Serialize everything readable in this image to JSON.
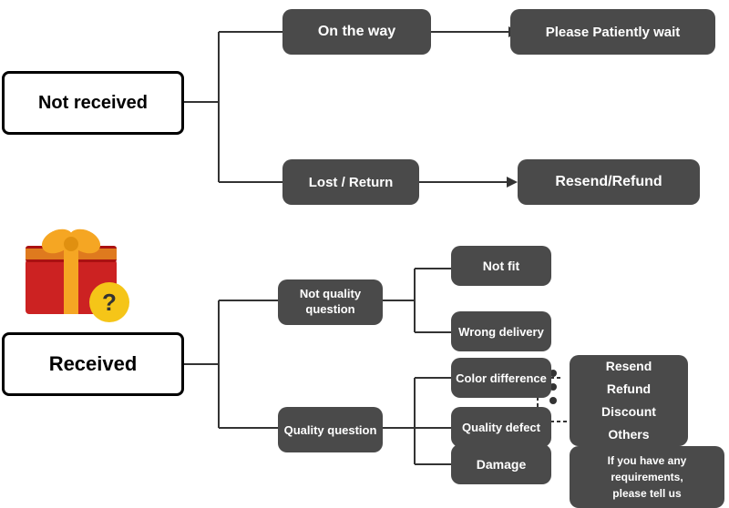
{
  "boxes": {
    "not_received": "Not received",
    "on_the_way": "On the way",
    "please_wait": "Please Patiently wait",
    "lost_return": "Lost / Return",
    "resend_refund": "Resend/Refund",
    "received": "Received",
    "not_quality": "Not quality\nquestion",
    "not_fit": "Not fit",
    "wrong_delivery": "Wrong delivery",
    "quality_question": "Quality question",
    "color_difference": "Color difference",
    "quality_defect": "Quality defect",
    "damage": "Damage",
    "options": "Resend\nRefund\nDiscount\nOthers",
    "requirements": "If you have any\nrequirements,\nplease tell us"
  },
  "colors": {
    "dark_box": "#4a4a4a",
    "main_border": "#000000",
    "arrow": "#333333",
    "gift_red": "#cc2222",
    "gift_dark_red": "#aa1111",
    "ribbon_yellow": "#f5a623",
    "badge_yellow": "#f5c518"
  }
}
